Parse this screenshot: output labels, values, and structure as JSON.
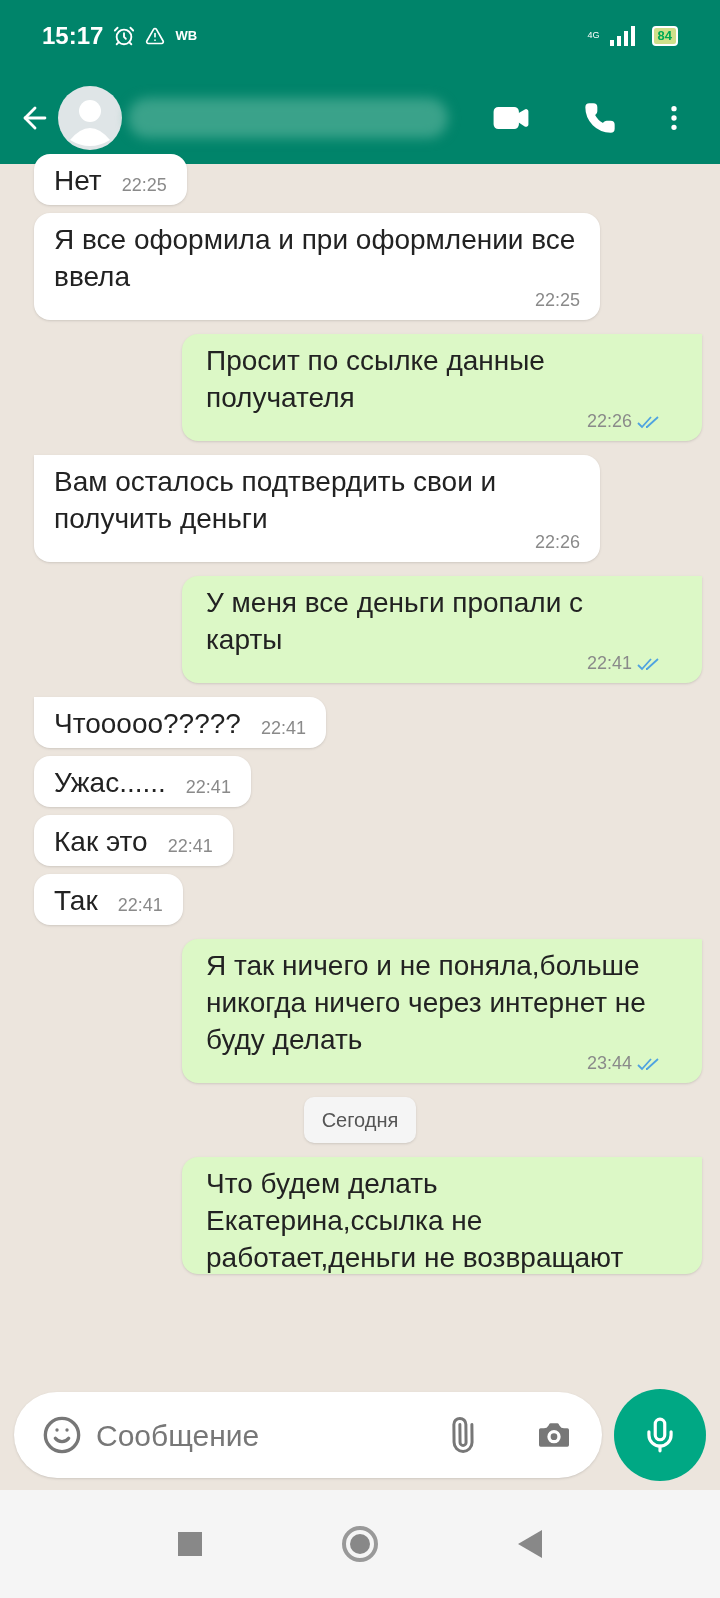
{
  "status_bar": {
    "time": "15:17",
    "app_badge": "WB",
    "network": "4G",
    "battery": "84"
  },
  "messages": [
    {
      "kind": "in",
      "text": "Нет",
      "time": "22:25",
      "tail": false
    },
    {
      "kind": "in",
      "text": "Я все оформила и при оформлении все ввела",
      "time": "22:25",
      "tail": false
    },
    {
      "kind": "out",
      "text": "Просит по ссылке данные получателя",
      "time": "22:26",
      "read": true,
      "tail": true
    },
    {
      "kind": "in",
      "text": "Вам осталось подтвердить свои и получить деньги",
      "time": "22:26",
      "tail": true
    },
    {
      "kind": "out",
      "text": "У меня все деньги пропали с карты",
      "time": "22:41",
      "read": true,
      "tail": true
    },
    {
      "kind": "in",
      "text": "Чтоoooo?????",
      "time": "22:41",
      "tail": true
    },
    {
      "kind": "in",
      "text": "Ужас......",
      "time": "22:41",
      "tail": false
    },
    {
      "kind": "in",
      "text": "Как это",
      "time": "22:41",
      "tail": false
    },
    {
      "kind": "in",
      "text": "Так",
      "time": "22:41",
      "tail": false
    },
    {
      "kind": "out",
      "text": "Я так ничего и не поняла,больше никогда ничего через интернет не буду делать",
      "time": "23:44",
      "read": true,
      "tail": true
    },
    {
      "kind": "date",
      "text": "Сегодня"
    },
    {
      "kind": "out",
      "text": "Что будем делать Екатерина,ссылка не работает,деньги не возвращают",
      "tail": true
    }
  ],
  "composer": {
    "placeholder": "Сообщение"
  }
}
